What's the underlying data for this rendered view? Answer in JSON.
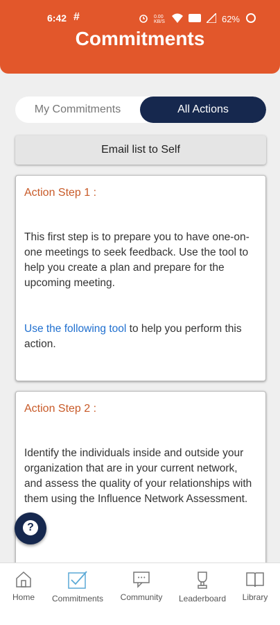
{
  "status": {
    "time": "6:42",
    "hash_icon": "#",
    "net_label": "0.00\nKB/S",
    "battery_text": "62%"
  },
  "header": {
    "title": "Commitments"
  },
  "tabs": {
    "my_label": "My Commitments",
    "all_label": "All Actions",
    "active": "All Actions"
  },
  "email_button": {
    "label": "Email list to Self"
  },
  "cards": [
    {
      "step": "Action Step 1 :",
      "body": "This first step is to prepare you to have one-on-one meetings to seek feedback. Use the tool to help you create a plan and prepare for the upcoming meeting.",
      "tool_link": "Use the following tool",
      "tool_rest": " to help you perform this action."
    },
    {
      "step": "Action Step 2 :",
      "body": "Identify the individuals inside and outside your organization that are in your current network, and assess the quality of your relationships with them using the Influence Network Assessment."
    }
  ],
  "nav": {
    "items": [
      {
        "label": "Home",
        "icon": "home-icon"
      },
      {
        "label": "Commitments",
        "icon": "commitments-icon"
      },
      {
        "label": "Community",
        "icon": "community-icon"
      },
      {
        "label": "Leaderboard",
        "icon": "trophy-icon"
      },
      {
        "label": "Library",
        "icon": "book-icon"
      }
    ]
  },
  "colors": {
    "header": "#e2572b",
    "navy": "#16284e",
    "step": "#c85a28",
    "link": "#1f6fcf"
  }
}
